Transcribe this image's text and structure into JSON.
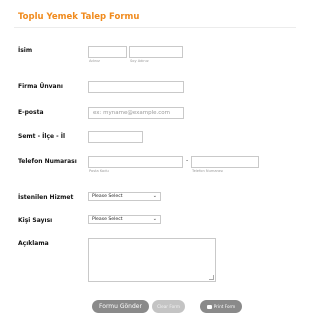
{
  "form": {
    "title": "Toplu Yemek Talep Formu"
  },
  "fields": {
    "name": {
      "label": "İsim",
      "first_sublabel": "Adınız",
      "last_sublabel": "Soy Adınız",
      "first_value": "",
      "last_value": ""
    },
    "company": {
      "label": "Firma Ünvanı",
      "value": ""
    },
    "email": {
      "label": "E-posta",
      "placeholder": "ex: myname@example.com"
    },
    "location": {
      "label": "Semt - İlçe - İl",
      "value": ""
    },
    "phone": {
      "label": "Telefon Numarası",
      "area_sublabel": "Posta Kodu",
      "number_sublabel": "Telefon Numarası",
      "separator": "-"
    },
    "service": {
      "label": "İstenilen Hizmet",
      "selected": "Please Select"
    },
    "people": {
      "label": "Kişi Sayısı",
      "selected": "Please Select"
    },
    "description": {
      "label": "Açıklama",
      "value": ""
    }
  },
  "buttons": {
    "submit": "Formu Gönder",
    "clear": "Clear Form",
    "print": "Print Form"
  },
  "colors": {
    "accent": "#f08a1c",
    "button": "#8a8a8a",
    "button_disabled": "#c4c4c4"
  }
}
